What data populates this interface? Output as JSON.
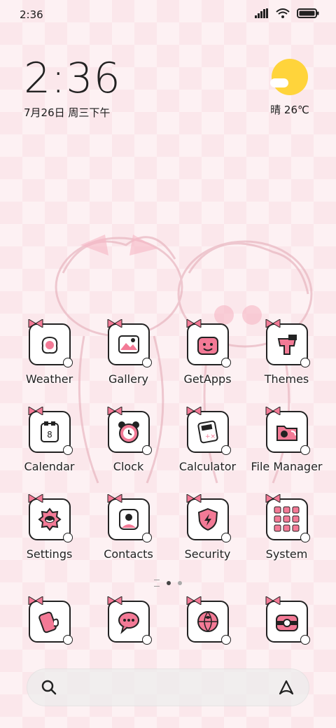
{
  "status_bar": {
    "time": "2:36",
    "icons": [
      "signal-icon",
      "wifi-icon",
      "battery-icon"
    ]
  },
  "clock_widget": {
    "time": "2:36",
    "date": "7月26日 周三下午"
  },
  "weather_widget": {
    "temp": "晴 26℃",
    "icon": "sun-cloud-icon"
  },
  "apps": [
    {
      "label": "Weather",
      "icon": "weather-icon"
    },
    {
      "label": "Gallery",
      "icon": "gallery-icon"
    },
    {
      "label": "GetApps",
      "icon": "getapps-icon"
    },
    {
      "label": "Themes",
      "icon": "themes-icon"
    },
    {
      "label": "Calendar",
      "icon": "calendar-icon",
      "day": "8"
    },
    {
      "label": "Clock",
      "icon": "clock-icon"
    },
    {
      "label": "Calculator",
      "icon": "calculator-icon"
    },
    {
      "label": "File Manager",
      "icon": "file-manager-icon"
    },
    {
      "label": "Settings",
      "icon": "settings-icon"
    },
    {
      "label": "Contacts",
      "icon": "contacts-icon"
    },
    {
      "label": "Security",
      "icon": "security-icon"
    },
    {
      "label": "System",
      "icon": "system-folder-icon"
    }
  ],
  "page_indicator": {
    "pages": 2,
    "current": 1
  },
  "dock": [
    {
      "icon": "phone-icon"
    },
    {
      "icon": "messages-icon"
    },
    {
      "icon": "browser-icon"
    },
    {
      "icon": "camera-icon"
    }
  ],
  "search_bar": {
    "left_icon": "search-icon",
    "right_icon": "assistant-icon"
  },
  "colors": {
    "accent_pink": "#f37a96",
    "check_pink": "#f7d3da",
    "sun": "#ffd43b",
    "outline": "#222222"
  }
}
